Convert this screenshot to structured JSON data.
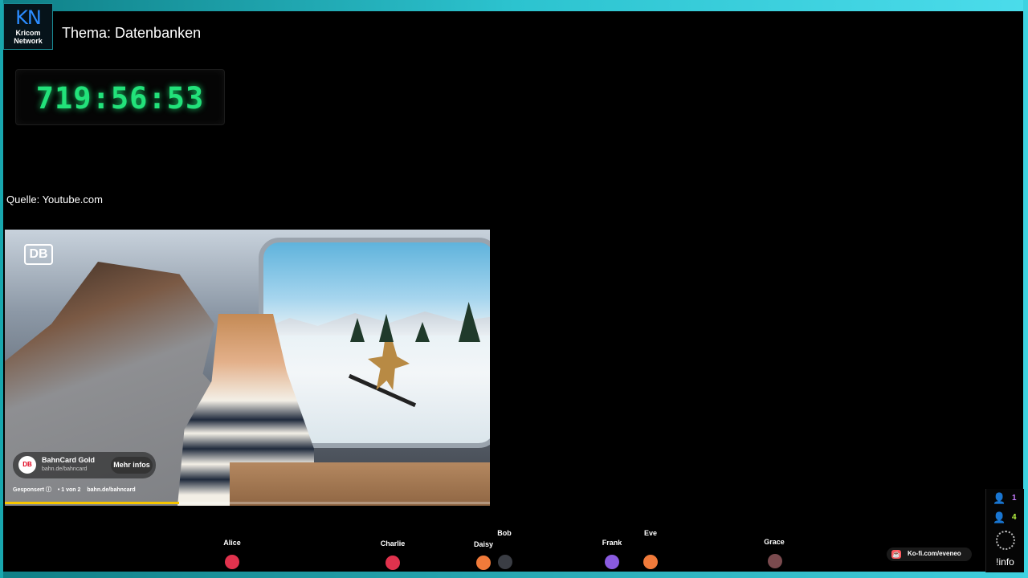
{
  "logo": {
    "initials": "KN",
    "line1": "Kricom",
    "line2": "Network"
  },
  "topic": "Thema: Datenbanken",
  "timer": "719:56:53",
  "source": "Quelle: Youtube.com",
  "video": {
    "brand_logo": "DB",
    "ad": {
      "icon_label": "DB",
      "title": "BahnCard Gold",
      "url": "bahn.de/bahncard",
      "button": "Mehr infos",
      "sponsored": "Gesponsert ⓘ",
      "position": "• 1 von 2",
      "meta_url": "bahn.de/bahncard"
    },
    "progress": 0.36
  },
  "participants": [
    {
      "name": "Alice",
      "color": "#e0324d"
    },
    {
      "name": "Charlie",
      "color": "#e0324d"
    },
    {
      "name": "Daisy",
      "color": "#f07a3a"
    },
    {
      "name": "Bob",
      "color": "#3a3d44"
    },
    {
      "name": "Frank",
      "color": "#8a5be0"
    },
    {
      "name": "Eve",
      "color": "#f07a3a"
    },
    {
      "name": "Grace",
      "color": "#7a4a4e"
    }
  ],
  "kofi": {
    "icon": "cup-icon",
    "label": "Ko-fi.com/eveneo"
  },
  "stats": {
    "viewers_count": "1",
    "viewers_color": "#c77dff",
    "followers_count": "4",
    "followers_color": "#b9f542",
    "info_label": "!info"
  }
}
